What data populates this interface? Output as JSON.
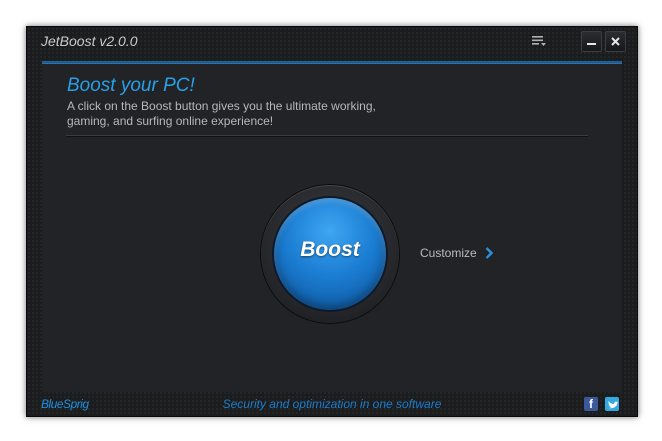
{
  "window": {
    "title": "JetBoost v2.0.0",
    "icons": {
      "menu": "menu-icon",
      "minimize": "minimize-icon",
      "close": "close-icon"
    }
  },
  "main": {
    "heading": "Boost your PC!",
    "description": "A click on the Boost button gives you the ultimate working, gaming, and surfing online experience!",
    "boost_label": "Boost",
    "customize_label": "Customize",
    "customize_icon": "chevron-right-icon"
  },
  "footer": {
    "brand": "BlueSprig",
    "tagline": "Security and optimization in one software",
    "social": [
      "facebook-icon",
      "twitter-icon"
    ]
  },
  "colors": {
    "accent": "#27a0e8",
    "button_blue": "#1c7ed3",
    "background": "#1b1c1e",
    "text": "#b5b8bc"
  }
}
